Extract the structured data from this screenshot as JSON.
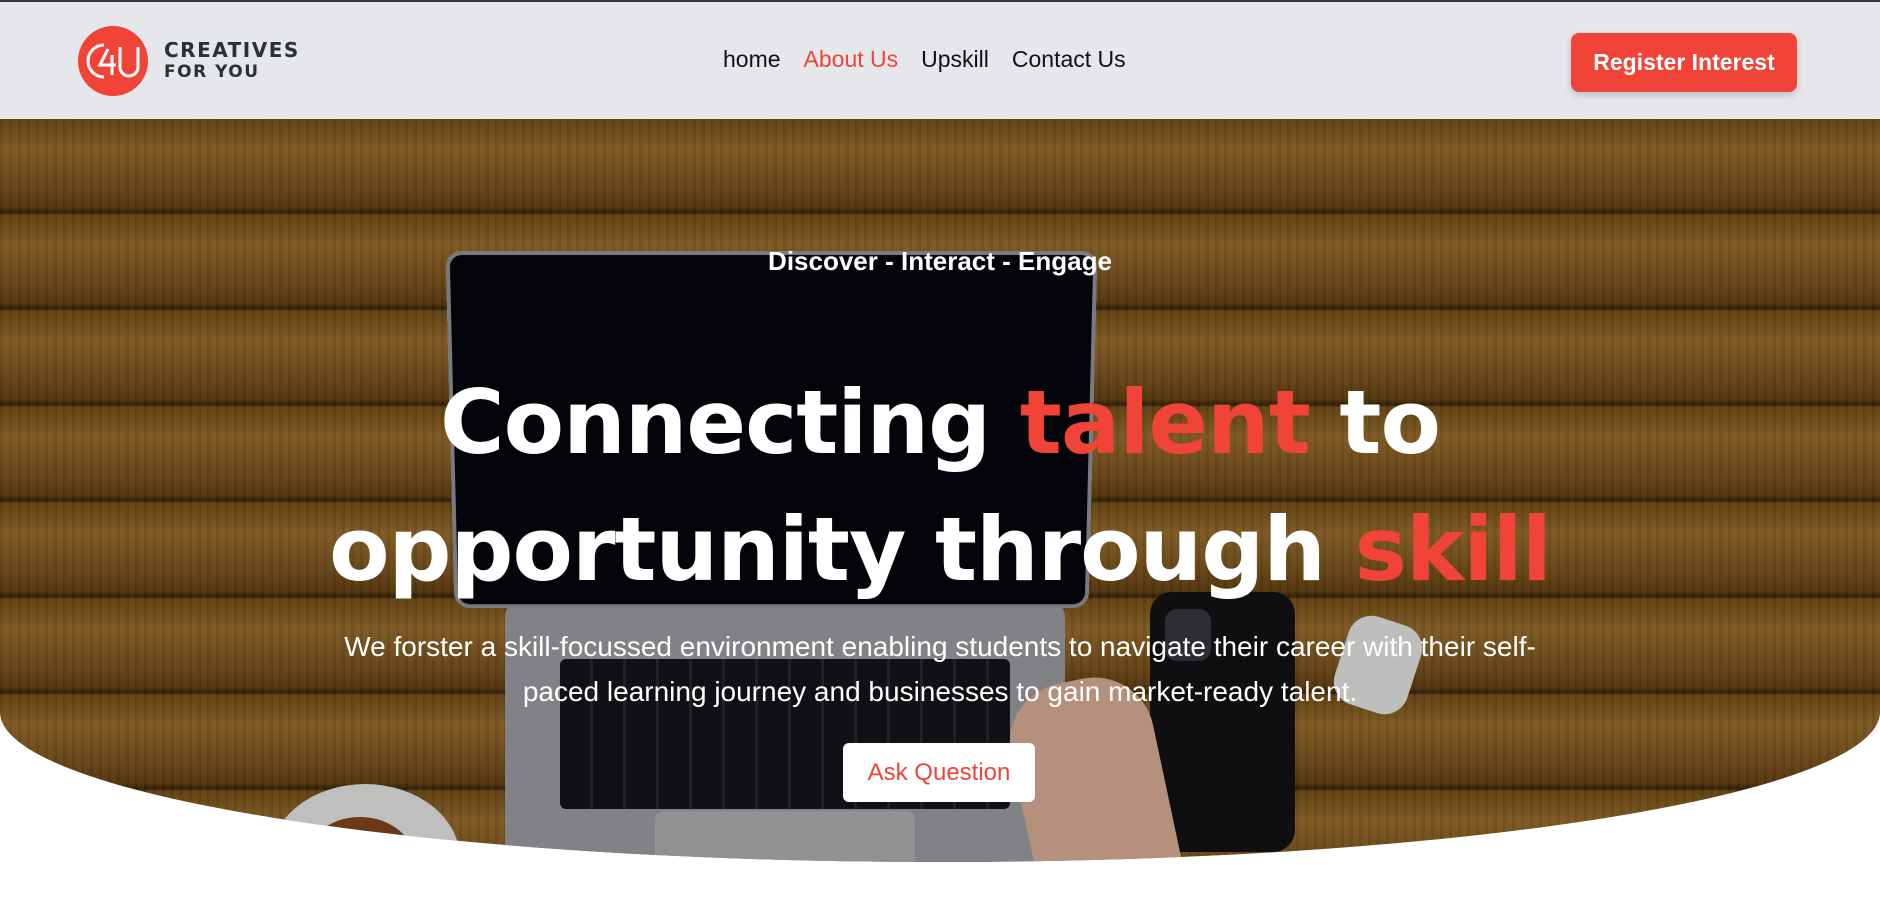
{
  "header": {
    "logo": {
      "mark_text": "C4U",
      "line1": "CREATIVES",
      "line2": "FOR YOU"
    },
    "nav": [
      {
        "label": "home",
        "active": false
      },
      {
        "label": "About Us",
        "active": true
      },
      {
        "label": "Upskill",
        "active": false
      },
      {
        "label": "Contact Us",
        "active": false
      }
    ],
    "register_label": "Register Interest"
  },
  "hero": {
    "tagline": "Discover - Interact - Engage",
    "headline": {
      "p1": "Connecting ",
      "accent1": "talent",
      "p2": " to",
      "p3": "opportunity through ",
      "accent2": "skill"
    },
    "subtext": "We forster a skill-focussed environment enabling students to navigate their career with their self-paced learning journey and businesses to gain market-ready talent.",
    "ask_label": "Ask Question"
  },
  "colors": {
    "accent": "#f04438",
    "header_bg": "#e6e7eb"
  }
}
